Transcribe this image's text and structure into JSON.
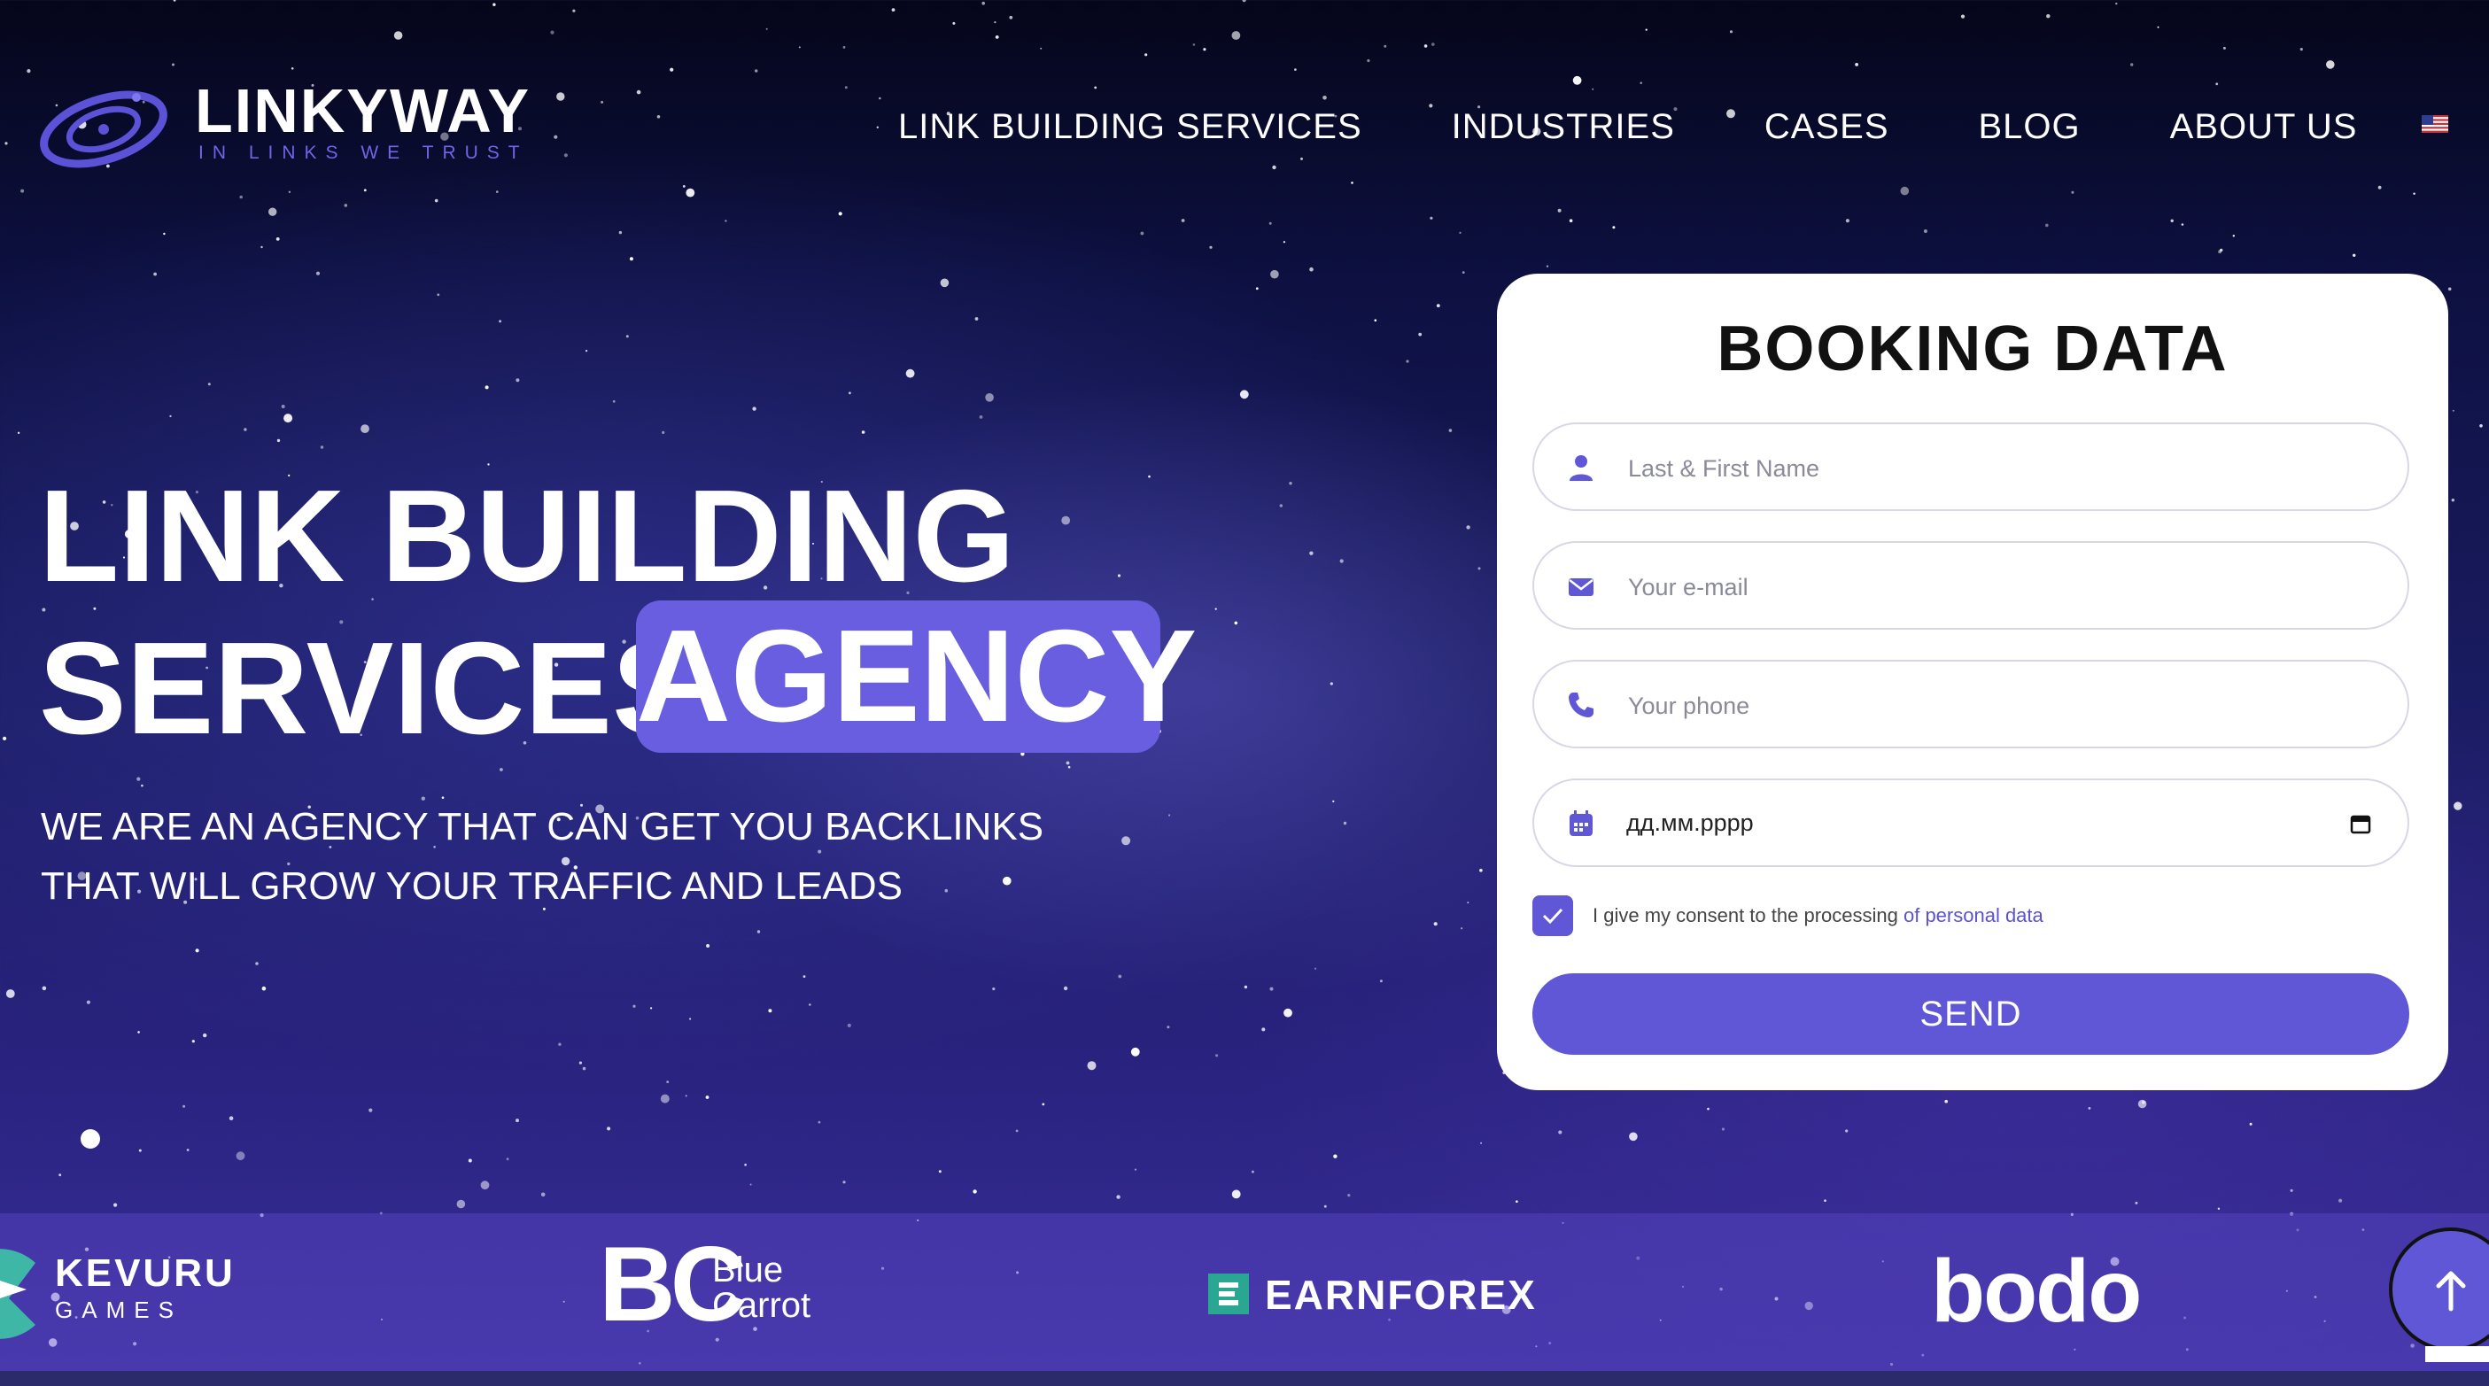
{
  "header": {
    "logo": {
      "name": "LINKYWAY",
      "tagline": "IN LINKS WE TRUST"
    },
    "nav": [
      {
        "label": "LINK BUILDING SERVICES"
      },
      {
        "label": "INDUSTRIES"
      },
      {
        "label": "CASES"
      },
      {
        "label": "BLOG"
      },
      {
        "label": "ABOUT US"
      }
    ],
    "language_icon": "us-flag-icon"
  },
  "hero": {
    "title_line1": "LINK BUILDING",
    "title_line2": "SERVICES",
    "title_badge": "AGENCY",
    "subtitle_line1": "WE ARE AN AGENCY THAT CAN GET YOU BACKLINKS",
    "subtitle_line2": "THAT WILL GROW YOUR TRAFFIC AND LEADS"
  },
  "booking_form": {
    "title": "BOOKING DATA",
    "name_field": {
      "placeholder": "Last & First Name",
      "value": "",
      "icon": "user-icon"
    },
    "email_field": {
      "placeholder": "Your e-mail",
      "value": "",
      "icon": "envelope-icon"
    },
    "phone_field": {
      "placeholder": "Your phone",
      "value": "",
      "icon": "phone-icon"
    },
    "date_field": {
      "value": "дд.мм.рррр",
      "icon": "calendar-icon"
    },
    "consent": {
      "checked": true,
      "text": "I give my consent to the processing",
      "link_text": "of personal data"
    },
    "send_label": "SEND"
  },
  "partners": {
    "kevuru": {
      "name": "KEVURU",
      "sub": "GAMES"
    },
    "blue_carrot": {
      "mark": "BC",
      "line1": "Blue",
      "line2": "Carrot"
    },
    "earnforex": {
      "name": "EARNFOREX"
    },
    "bodo": {
      "name": "bodo"
    }
  },
  "scroll_top_icon": "arrow-up-icon",
  "colors": {
    "accent": "#5f57d6",
    "badge": "#6a5ee0",
    "earnforex_green": "#2aa792"
  }
}
